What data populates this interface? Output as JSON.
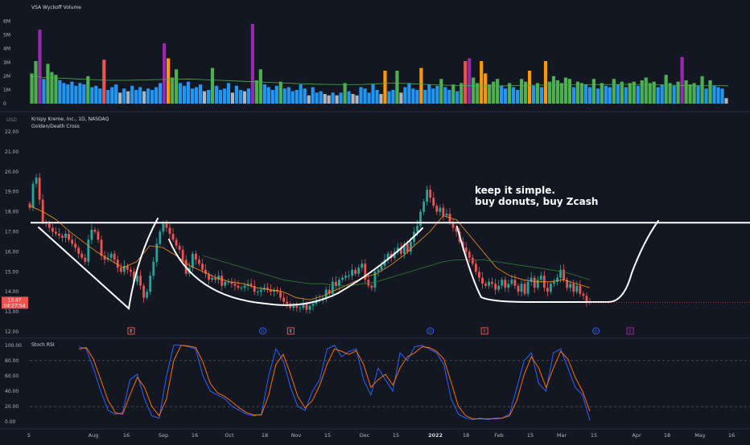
{
  "colors": {
    "background": "#131722",
    "separator": "#2a2e39",
    "text": "#b2b5be",
    "up": "#26a69a",
    "down": "#ef5350",
    "ema_fast": "#f7931a",
    "ema_slow": "#2e7d32",
    "vol_avg": "#4caf50",
    "vol_blue": "#2196f3",
    "vol_green": "#4caf50",
    "vol_orange": "#ff9800",
    "vol_red": "#ef5350",
    "vol_purple": "#9c27b0",
    "vol_gray": "#b2b5be",
    "rsi_k": "#2962ff",
    "rsi_d": "#ff6d00",
    "drawing": "#ffffff",
    "price_tag": "#ef5350"
  },
  "header": {
    "currency": "USD",
    "volume_title": "VSA Wyckoff Volume",
    "symbol": "Krispy Kreme, Inc., 1D, NASDAQ",
    "indicator": "Golden/Death Cross",
    "rsi_title": "Stoch RSI"
  },
  "annotation": [
    "keep it simple.",
    "buy donuts,  buy  Zcash"
  ],
  "price_tag": {
    "price": "13.47",
    "countdown": "04:27:54"
  },
  "chart_data": [
    {
      "type": "bar",
      "title": "VSA Wyckoff Volume",
      "ylim": [
        0,
        6.5
      ],
      "y_ticks": [
        {
          "v": 0,
          "l": "0"
        },
        {
          "v": 1,
          "l": "1M"
        },
        {
          "v": 2,
          "l": "2M"
        },
        {
          "v": 3,
          "l": "3M"
        },
        {
          "v": 4,
          "l": "4M"
        },
        {
          "v": 5,
          "l": "5M"
        },
        {
          "v": 6,
          "l": "6M"
        }
      ],
      "values": [
        2.2,
        3.1,
        5.4,
        1.8,
        2.9,
        2.3,
        2.1,
        1.7,
        1.5,
        1.4,
        1.6,
        1.3,
        1.5,
        1.4,
        2.0,
        1.2,
        1.3,
        1.1,
        3.2,
        1.0,
        1.2,
        1.4,
        0.8,
        1.1,
        0.9,
        1.3,
        1.0,
        1.2,
        0.9,
        1.1,
        1.0,
        1.2,
        1.5,
        4.4,
        3.3,
        1.9,
        2.5,
        1.5,
        1.3,
        1.6,
        1.1,
        1.2,
        1.4,
        0.9,
        1.0,
        2.6,
        1.3,
        1.0,
        1.1,
        1.5,
        0.8,
        1.3,
        1.0,
        0.9,
        1.1,
        5.8,
        1.7,
        2.5,
        1.4,
        1.2,
        1.0,
        1.3,
        1.6,
        1.1,
        1.2,
        0.9,
        1.0,
        1.4,
        1.1,
        0.6,
        1.2,
        0.8,
        0.9,
        0.7,
        0.6,
        0.8,
        0.6,
        0.8,
        1.5,
        0.9,
        0.7,
        0.6,
        1.2,
        1.1,
        0.8,
        1.4,
        1.0,
        0.7,
        2.4,
        0.9,
        1.0,
        2.4,
        0.8,
        1.2,
        1.5,
        1.1,
        1.0,
        2.6,
        1.0,
        1.4,
        1.1,
        1.3,
        1.8,
        1.2,
        1.0,
        1.4,
        0.9,
        1.5,
        3.1,
        3.3,
        1.9,
        1.5,
        3.1,
        2.2,
        1.4,
        1.6,
        1.8,
        1.3,
        1.1,
        1.5,
        1.2,
        1.0,
        1.8,
        1.6,
        2.4,
        1.3,
        1.5,
        1.2,
        3.1,
        1.6,
        2.0,
        1.7,
        1.5,
        1.9,
        1.8,
        1.2,
        1.6,
        1.5,
        1.4,
        1.2,
        1.8,
        1.1,
        1.5,
        1.3,
        1.2,
        1.8,
        1.4,
        1.6,
        1.2,
        1.5,
        1.6,
        1.3,
        1.7,
        1.9,
        1.5,
        1.6,
        1.2,
        1.4,
        2.1,
        1.5,
        1.3,
        1.6,
        3.4,
        1.7,
        1.4,
        1.5,
        1.3,
        2.0,
        1.1,
        1.7,
        1.3,
        1.2,
        1.1,
        0.4
      ],
      "avg_line": [
        2.0,
        1.9,
        1.85,
        1.8,
        1.75,
        1.7,
        1.7,
        1.72,
        1.75,
        1.78,
        1.8,
        1.75,
        1.7,
        1.65,
        1.6,
        1.55,
        1.5,
        1.45,
        1.42,
        1.4,
        1.38,
        1.4,
        1.45,
        1.5,
        1.45,
        1.4,
        1.35,
        1.32,
        1.3,
        1.28,
        1.3,
        1.32,
        1.35,
        1.36,
        1.37,
        1.38,
        1.39,
        1.4,
        1.4,
        1.38,
        1.35,
        1.33,
        1.32,
        1.31,
        1.3
      ]
    },
    {
      "type": "line",
      "title": "Krispy Kreme, Inc., 1D, NASDAQ",
      "ylim": [
        12,
        22
      ],
      "y_ticks": [
        "12.00",
        "13.00",
        "14.00",
        "15.00",
        "16.00",
        "17.00",
        "18.00",
        "19.00",
        "20.00",
        "21.00",
        "22.00"
      ],
      "x_ticks": [
        "5",
        "Aug",
        "16",
        "Sep",
        "16",
        "Oct",
        "18",
        "Nov",
        "15",
        "Dec",
        "15",
        "2022",
        "18",
        "Feb",
        "15",
        "Mar",
        "15",
        "Apr",
        "18",
        "May",
        "16"
      ],
      "series": [
        {
          "key": "close",
          "values": [
            18.2,
            19.4,
            19.7,
            18.6,
            17.5,
            17.4,
            17.2,
            17.0,
            16.9,
            16.8,
            16.7,
            16.9,
            16.6,
            16.4,
            16.2,
            15.9,
            15.7,
            15.5,
            16.6,
            17.1,
            17.0,
            16.6,
            15.8,
            15.6,
            15.7,
            15.9,
            15.6,
            15.2,
            15.0,
            15.3,
            15.1,
            15.0,
            14.5,
            14.8,
            14.3,
            13.7,
            14.0,
            14.8,
            15.5,
            16.4,
            17.0,
            17.4,
            17.2,
            16.9,
            16.6,
            16.3,
            16.1,
            15.6,
            14.9,
            15.2,
            15.9,
            15.6,
            15.4,
            15.1,
            14.9,
            14.6,
            14.7,
            14.6,
            14.8,
            14.3,
            14.5,
            14.5,
            14.4,
            14.3,
            14.2,
            14.2,
            14.3,
            14.4,
            14.3,
            14.0,
            14.0,
            14.1,
            14.2,
            14.1,
            14.0,
            14.1,
            14.0,
            13.7,
            13.5,
            13.4,
            13.2,
            13.3,
            13.2,
            13.2,
            13.4,
            13.1,
            13.3,
            13.4,
            13.6,
            13.6,
            13.7,
            14.1,
            13.9,
            14.5,
            14.3,
            14.6,
            14.7,
            14.8,
            14.8,
            15.1,
            14.9,
            15.2,
            15.4,
            14.6,
            14.3,
            14.2,
            15.0,
            15.1,
            15.3,
            15.6,
            15.9,
            15.7,
            16.0,
            16.2,
            15.9,
            16.4,
            16.0,
            16.5,
            17.0,
            17.3,
            18.0,
            18.5,
            19.1,
            18.7,
            18.3,
            18.0,
            18.2,
            17.8,
            17.9,
            17.5,
            17.2,
            17.0,
            16.5,
            16.2,
            16.0,
            15.7,
            15.4,
            15.0,
            14.7,
            14.4,
            14.3,
            14.5,
            14.4,
            14.1,
            14.3,
            14.6,
            14.2,
            14.4,
            14.6,
            14.3,
            14.0,
            14.4,
            13.9,
            14.5,
            14.7,
            14.2,
            14.6,
            14.8,
            14.2,
            14.0,
            14.4,
            14.5,
            14.7,
            15.1,
            14.6,
            14.2,
            14.4,
            14.0,
            14.3,
            13.9,
            13.8,
            13.5,
            13.47
          ]
        },
        {
          "key": "ema_fast",
          "values": [
            18.3,
            18.0,
            17.6,
            17.0,
            16.5,
            16.0,
            15.6,
            15.2,
            15.5,
            16.3,
            16.2,
            15.8,
            15.3,
            15.0,
            14.7,
            14.5,
            14.4,
            14.2,
            14.1,
            14.0,
            13.7,
            13.6,
            13.8,
            14.1,
            14.4,
            14.7,
            14.9,
            15.3,
            15.8,
            16.4,
            17.0,
            17.8,
            17.6,
            16.8,
            16.0,
            15.2,
            14.8,
            14.6,
            14.5,
            14.5,
            14.6,
            14.4,
            14.2
          ]
        },
        {
          "key": "ema_slow",
          "values": [
            null,
            null,
            null,
            null,
            null,
            null,
            null,
            null,
            null,
            null,
            null,
            null,
            null,
            15.8,
            15.6,
            15.4,
            15.2,
            15.0,
            14.8,
            14.6,
            14.5,
            14.4,
            14.4,
            14.3,
            14.3,
            14.4,
            14.5,
            14.7,
            14.9,
            15.1,
            15.3,
            15.5,
            15.6,
            15.6,
            15.6,
            15.5,
            15.4,
            15.3,
            15.2,
            15.1,
            15.0,
            14.8,
            14.6
          ]
        }
      ]
    },
    {
      "type": "line",
      "title": "Stoch RSI",
      "ylim": [
        -5,
        105
      ],
      "y_ticks": [
        "0.00",
        "20.00",
        "40.00",
        "60.00",
        "80.00",
        "100.00"
      ],
      "bands": [
        20,
        80
      ],
      "series": [
        {
          "key": "k",
          "values": [
            98,
            95,
            70,
            40,
            15,
            10,
            12,
            55,
            62,
            30,
            8,
            5,
            60,
            100,
            100,
            98,
            95,
            60,
            40,
            35,
            30,
            20,
            15,
            10,
            8,
            10,
            60,
            95,
            80,
            45,
            20,
            15,
            40,
            55,
            95,
            100,
            85,
            92,
            95,
            55,
            35,
            70,
            55,
            40,
            90,
            80,
            98,
            100,
            95,
            90,
            75,
            30,
            10,
            5,
            3,
            5,
            3,
            5,
            5,
            10,
            45,
            80,
            90,
            50,
            40,
            90,
            95,
            70,
            45,
            35,
            2
          ]
        },
        {
          "key": "d",
          "values": [
            95,
            97,
            82,
            55,
            28,
            12,
            10,
            35,
            58,
            45,
            20,
            8,
            30,
            80,
            100,
            99,
            97,
            78,
            50,
            38,
            33,
            26,
            18,
            12,
            9,
            9,
            35,
            75,
            88,
            62,
            33,
            18,
            28,
            48,
            75,
            95,
            92,
            88,
            93,
            75,
            45,
            55,
            62,
            48,
            70,
            85,
            90,
            98,
            97,
            92,
            82,
            52,
            20,
            8,
            4,
            4,
            4,
            4,
            5,
            8,
            28,
            62,
            85,
            70,
            45,
            70,
            92,
            82,
            58,
            40,
            14
          ]
        }
      ]
    }
  ],
  "markers": [
    {
      "x": 0.181,
      "type": "earn",
      "text": "E"
    },
    {
      "x": 0.416,
      "type": "div",
      "text": "D"
    },
    {
      "x": 0.466,
      "type": "earn",
      "text": "E"
    },
    {
      "x": 0.715,
      "type": "div",
      "text": "D"
    },
    {
      "x": 0.812,
      "type": "earnr",
      "text": "E"
    },
    {
      "x": 1.011,
      "type": "div",
      "text": "D"
    },
    {
      "x": 1.072,
      "type": "split",
      "text": "E"
    }
  ]
}
